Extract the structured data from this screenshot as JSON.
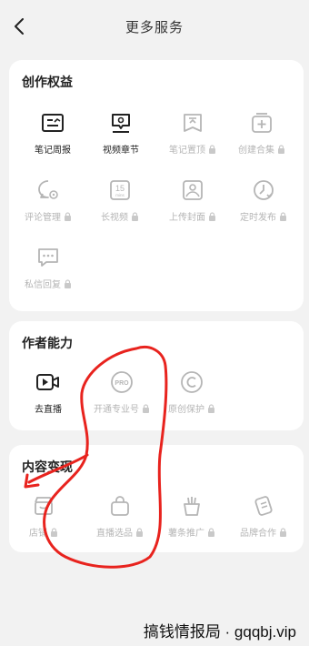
{
  "header": {
    "title": "更多服务"
  },
  "sections": [
    {
      "title": "创作权益",
      "items": [
        {
          "label": "笔记周报",
          "icon": "report-icon",
          "locked": false
        },
        {
          "label": "视频章节",
          "icon": "video-chapter-icon",
          "locked": false
        },
        {
          "label": "笔记置顶",
          "icon": "pin-top-icon",
          "locked": true
        },
        {
          "label": "创建合集",
          "icon": "collection-icon",
          "locked": true
        },
        {
          "label": "评论管理",
          "icon": "comment-manage-icon",
          "locked": true
        },
        {
          "label": "长视频",
          "icon": "long-video-icon",
          "locked": true,
          "icon_text": "15",
          "icon_subtext": "mins"
        },
        {
          "label": "上传封面",
          "icon": "cover-upload-icon",
          "locked": true
        },
        {
          "label": "定时发布",
          "icon": "schedule-icon",
          "locked": true
        },
        {
          "label": "私信回复",
          "icon": "message-reply-icon",
          "locked": true
        }
      ]
    },
    {
      "title": "作者能力",
      "items": [
        {
          "label": "去直播",
          "icon": "live-camera-icon",
          "locked": false
        },
        {
          "label": "开通专业号",
          "icon": "pro-badge-icon",
          "locked": true,
          "icon_text": "PRO"
        },
        {
          "label": "原创保护",
          "icon": "copyright-icon",
          "locked": true
        }
      ]
    },
    {
      "title": "内容变现",
      "items": [
        {
          "label": "店铺",
          "icon": "store-icon",
          "locked": true
        },
        {
          "label": "直播选品",
          "icon": "shopping-bag-icon",
          "locked": true
        },
        {
          "label": "薯条推广",
          "icon": "fries-promo-icon",
          "locked": true
        },
        {
          "label": "品牌合作",
          "icon": "brand-coop-icon",
          "locked": true
        }
      ]
    }
  ],
  "watermark": "搞钱情报局 · gqqbj.vip",
  "colors": {
    "active": "#222222",
    "disabled": "#b5b5b5",
    "annotation": "#e8231e",
    "background": "#f2f2f2"
  }
}
